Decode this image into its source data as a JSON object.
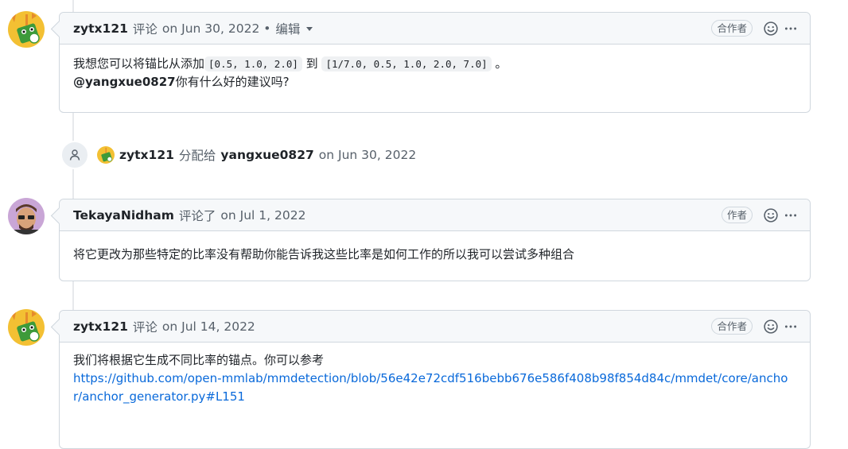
{
  "comments": [
    {
      "author": "zytx121",
      "verb": "评论",
      "date": "on Jun 30, 2022 •",
      "edited": "编辑",
      "role": "合作者",
      "body_parts": {
        "t1": "我想您可以将锚比从添加",
        "code1": "[0.5, 1.0, 2.0]",
        "t2": " 到 ",
        "code2": "[1/7.0, 0.5, 1.0, 2.0, 7.0]",
        "t3": " 。",
        "mention": "@yangxue0827",
        "t4": "你有什么好的建议吗?"
      }
    },
    {
      "author": "TekayaNidham",
      "verb": "评论了",
      "date": "on Jul 1, 2022",
      "role": "作者",
      "body": "将它更改为那些特定的比率没有帮助你能告诉我这些比率是如何工作的所以我可以尝试多种组合"
    },
    {
      "author": "zytx121",
      "verb": "评论",
      "date": "on Jul 14, 2022",
      "role": "合作者",
      "body": "我们将根据它生成不同比率的锚点。你可以参考",
      "link": "https://github.com/open-mmlab/mmdetection/blob/56e42e72cdf516bebb676e586f408b98f854d84c/mmdet/core/anchor/anchor_generator.py#L151"
    }
  ],
  "event": {
    "actor": "zytx121",
    "action": "分配给",
    "assignee": "yangxue0827",
    "date": "on Jun 30, 2022"
  },
  "icons": {
    "smiley": "smiley-icon",
    "kebab": "kebab-horizontal-icon",
    "person": "person-icon"
  },
  "colors": {
    "link": "#0969da",
    "border": "#d0d7de",
    "header_bg": "#f6f8fa"
  }
}
